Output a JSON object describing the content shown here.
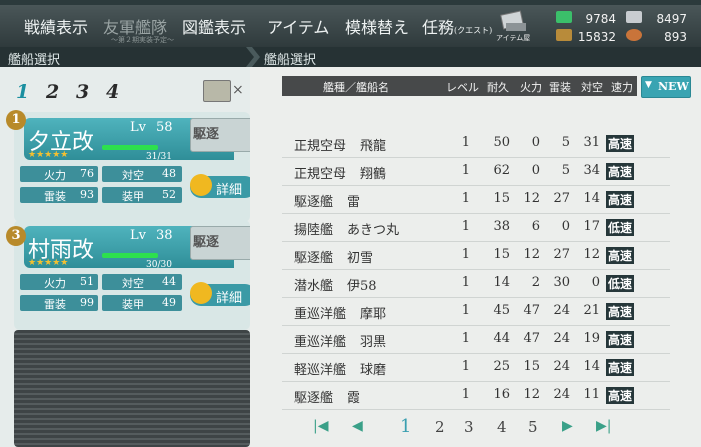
{
  "menu": {
    "items": [
      {
        "label": "戦績表示",
        "dim": false
      },
      {
        "label": "友軍艦隊",
        "dim": true,
        "sub": "～第２期実装予定～"
      },
      {
        "label": "図鑑表示",
        "dim": false
      },
      {
        "label": "アイテム",
        "dim": false
      },
      {
        "label": "模様替え",
        "dim": false
      },
      {
        "label": "任務",
        "dim": false,
        "small": "(クエスト)"
      }
    ],
    "item_shop_label": "アイテム屋"
  },
  "resources": {
    "fuel": "9784",
    "steel": "8497",
    "ammo": "15832",
    "bauxite": "893"
  },
  "crumbs": {
    "left": "艦船選択",
    "right": "艦船選択"
  },
  "fleet_tabs": [
    "1",
    "2",
    "3",
    "4"
  ],
  "fleet": [
    {
      "slot": "1",
      "name": "夕立改",
      "lv_label": "Lv",
      "level": "58",
      "stars": "★★★★★",
      "hp": "31/31",
      "hp_fill": 1.0,
      "speed": "駆逐",
      "stats": {
        "firepower_label": "火力",
        "firepower": "76",
        "aa_label": "対空",
        "aa": "48",
        "torpedo_label": "雷装",
        "torpedo": "93",
        "armor_label": "装甲",
        "armor": "52"
      },
      "detail_label": "詳細"
    },
    {
      "slot": "3",
      "name": "村雨改",
      "lv_label": "Lv",
      "level": "38",
      "stars": "★★★★★",
      "hp": "30/30",
      "hp_fill": 1.0,
      "speed": "駆逐",
      "stats": {
        "firepower_label": "火力",
        "firepower": "51",
        "aa_label": "対空",
        "aa": "44",
        "torpedo_label": "雷装",
        "torpedo": "99",
        "armor_label": "装甲",
        "armor": "49"
      },
      "detail_label": "詳細"
    }
  ],
  "list": {
    "headers": {
      "type_name": "艦種／艦船名",
      "level": "レベル",
      "hp": "耐久",
      "firepower": "火力",
      "torpedo": "雷装",
      "aa": "対空",
      "speed": "速力"
    },
    "new_label": "NEW",
    "rows": [
      {
        "type": "正規空母",
        "name": "飛龍",
        "level": "1",
        "hp": "50",
        "firepower": "0",
        "torpedo": "5",
        "aa": "31",
        "speed": "高速",
        "fast": true
      },
      {
        "type": "正規空母",
        "name": "翔鶴",
        "level": "1",
        "hp": "62",
        "firepower": "0",
        "torpedo": "5",
        "aa": "34",
        "speed": "高速",
        "fast": true
      },
      {
        "type": "駆逐艦",
        "name": "雷",
        "level": "1",
        "hp": "15",
        "firepower": "12",
        "torpedo": "27",
        "aa": "14",
        "speed": "高速",
        "fast": true
      },
      {
        "type": "揚陸艦",
        "name": "あきつ丸",
        "level": "1",
        "hp": "38",
        "firepower": "6",
        "torpedo": "0",
        "aa": "17",
        "speed": "低速",
        "fast": false
      },
      {
        "type": "駆逐艦",
        "name": "初雪",
        "level": "1",
        "hp": "15",
        "firepower": "12",
        "torpedo": "27",
        "aa": "12",
        "speed": "高速",
        "fast": true
      },
      {
        "type": "潜水艦",
        "name": "伊58",
        "level": "1",
        "hp": "14",
        "firepower": "2",
        "torpedo": "30",
        "aa": "0",
        "speed": "低速",
        "fast": false
      },
      {
        "type": "重巡洋艦",
        "name": "摩耶",
        "level": "1",
        "hp": "45",
        "firepower": "47",
        "torpedo": "24",
        "aa": "21",
        "speed": "高速",
        "fast": true
      },
      {
        "type": "重巡洋艦",
        "name": "羽黒",
        "level": "1",
        "hp": "44",
        "firepower": "47",
        "torpedo": "24",
        "aa": "19",
        "speed": "高速",
        "fast": true
      },
      {
        "type": "軽巡洋艦",
        "name": "球磨",
        "level": "1",
        "hp": "25",
        "firepower": "15",
        "torpedo": "24",
        "aa": "14",
        "speed": "高速",
        "fast": true
      },
      {
        "type": "駆逐艦",
        "name": "霞",
        "level": "1",
        "hp": "16",
        "firepower": "12",
        "torpedo": "24",
        "aa": "11",
        "speed": "高速",
        "fast": true
      }
    ]
  },
  "pagination": {
    "first": "|◀",
    "prev": "◀",
    "pages": [
      "1",
      "2",
      "3",
      "4",
      "5"
    ],
    "active": "1",
    "next": "▶",
    "last": "▶|"
  }
}
